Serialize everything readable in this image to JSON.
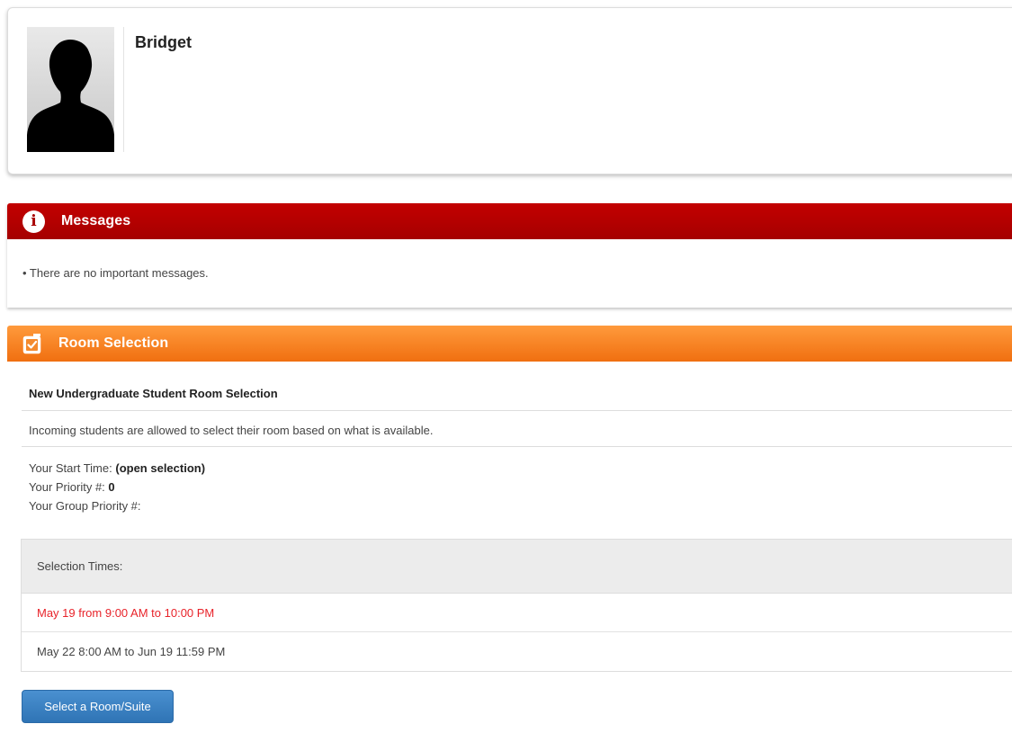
{
  "profile": {
    "name": "Bridget"
  },
  "messages": {
    "title": "Messages",
    "icon": "info-icon",
    "accent_color": "#a80000",
    "items": [
      "• There are no important messages."
    ]
  },
  "room_selection": {
    "title": "Room Selection",
    "icon": "checkbox-icon",
    "accent_color": "#f57a1f",
    "heading": "New Undergraduate Student Room Selection",
    "description": "Incoming students are allowed to select their room based on what is available.",
    "start_time_label": "Your Start Time:",
    "start_time_value": "(open selection)",
    "priority_label": "Your Priority #:",
    "priority_value": "0",
    "group_priority_label": "Your Group Priority #:",
    "group_priority_value": "",
    "selection_times": {
      "header": "Selection Times:",
      "rows": [
        {
          "text": "May 19 from 9:00 AM to 10:00 PM",
          "highlighted": true,
          "color": "#e8232a"
        },
        {
          "text": "May 22 8:00 AM to Jun 19 11:59 PM",
          "highlighted": false
        }
      ]
    },
    "select_button_label": "Select a Room/Suite",
    "button_color": "#337ab7"
  }
}
